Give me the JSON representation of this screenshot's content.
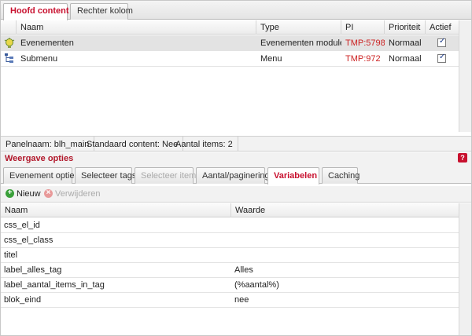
{
  "top_tabs": [
    {
      "label": "Hoofd content",
      "active": true
    },
    {
      "label": "Rechter kolom",
      "active": false
    }
  ],
  "grid": {
    "columns": [
      "Naam",
      "Type",
      "PI",
      "Prioriteit",
      "Actief"
    ],
    "rows": [
      {
        "icon": "lightbulb-icon",
        "name": "Evenementen",
        "type": "Evenementen module",
        "pi": "TMP:5798",
        "priority": "Normaal",
        "active": true
      },
      {
        "icon": "menu-tree-icon",
        "name": "Submenu",
        "type": "Menu",
        "pi": "TMP:972",
        "priority": "Normaal",
        "active": true
      }
    ]
  },
  "status_bar": {
    "panel_name": "Panelnaam: blh_main",
    "default_content": "Standaard content: Nee",
    "item_count": "Aantal items: 2"
  },
  "section": {
    "title": "Weergave opties",
    "help": "?"
  },
  "sub_tabs": [
    {
      "label": "Evenement opties",
      "state": "normal"
    },
    {
      "label": "Selecteer tags",
      "state": "normal"
    },
    {
      "label": "Selecteer items",
      "state": "disabled"
    },
    {
      "label": "Aantal/paginering",
      "state": "normal"
    },
    {
      "label": "Variabelen",
      "state": "active"
    },
    {
      "label": "Caching",
      "state": "normal"
    }
  ],
  "toolbar": {
    "new_label": "Nieuw",
    "new_icon": "plus-icon",
    "delete_label": "Verwijderen",
    "delete_icon": "remove-icon"
  },
  "variables": {
    "columns": [
      "Naam",
      "Waarde"
    ],
    "rows": [
      {
        "name": "css_el_id",
        "value": ""
      },
      {
        "name": "css_el_class",
        "value": ""
      },
      {
        "name": "titel",
        "value": ""
      },
      {
        "name": "label_alles_tag",
        "value": "Alles"
      },
      {
        "name": "label_aantal_items_in_tag",
        "value": "(%aantal%)"
      },
      {
        "name": "blok_eind",
        "value": "nee"
      }
    ]
  },
  "colors": {
    "accent_red": "#c8102e",
    "pi_red": "#cc2222",
    "selected_row": "#e3e3e3"
  }
}
